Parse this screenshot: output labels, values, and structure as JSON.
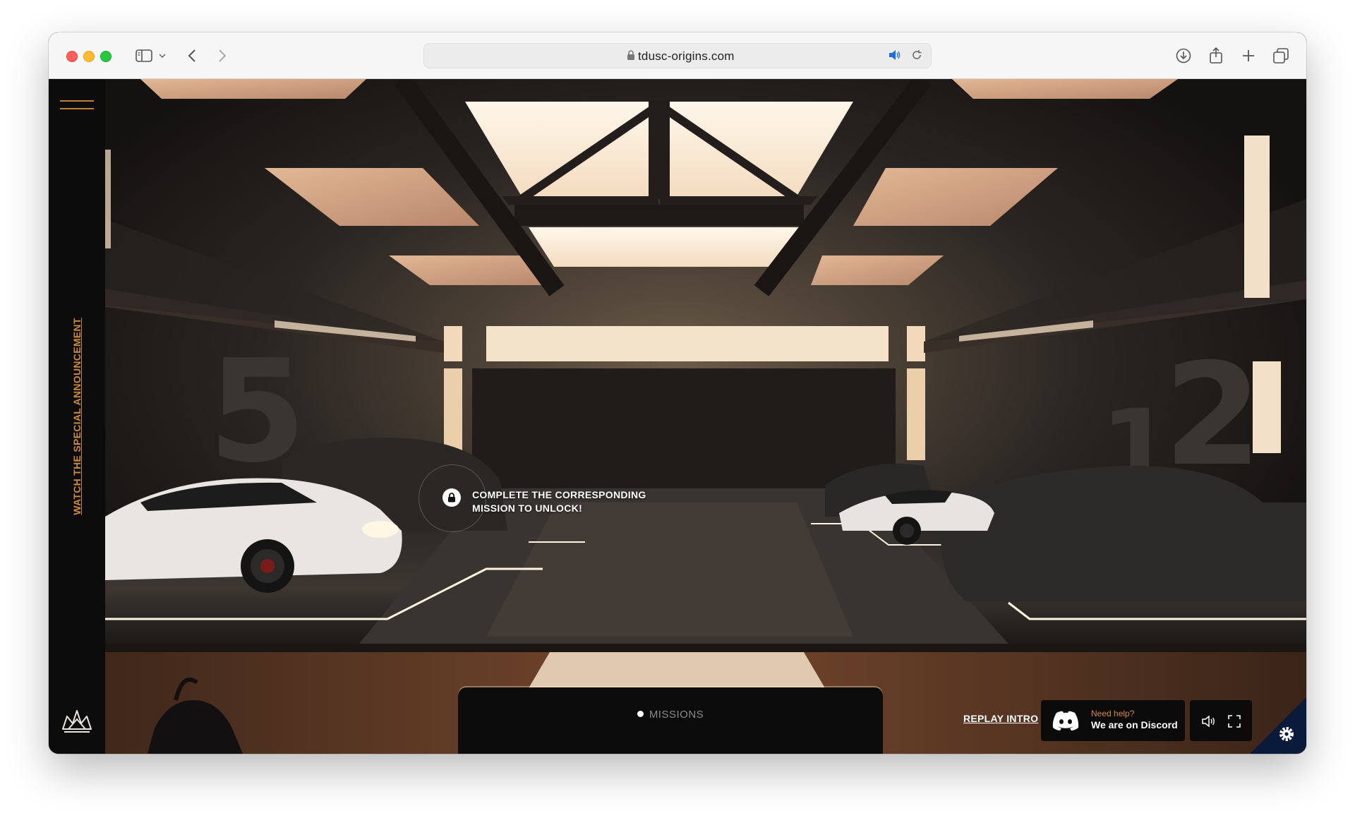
{
  "browser": {
    "url": "tdusc-origins.com"
  },
  "sidebar": {
    "announcement_link": "WATCH THE SPECIAL ANNOUNCEMENT"
  },
  "scene": {
    "lock_message_line1": "COMPLETE THE CORRESPONDING",
    "lock_message_line2": "MISSION TO UNLOCK!",
    "garage_numbers": [
      "5",
      "1",
      "2"
    ]
  },
  "bottom_bar": {
    "missions_label": "MISSIONS",
    "replay_intro_label": "REPLAY INTRO",
    "discord_small": "Need help?",
    "discord_big": "We are on Discord"
  },
  "icons": {
    "menu": "hamburger-icon",
    "logo": "crown-logo-icon",
    "lock": "lock-icon",
    "discord": "discord-icon",
    "sound": "speaker-icon",
    "fullscreen": "fullscreen-icon",
    "settings": "gear-icon"
  },
  "colors": {
    "accent": "#c98a3c",
    "panel": "#0d0c0c",
    "settings_bg": "#0a1a3a"
  }
}
